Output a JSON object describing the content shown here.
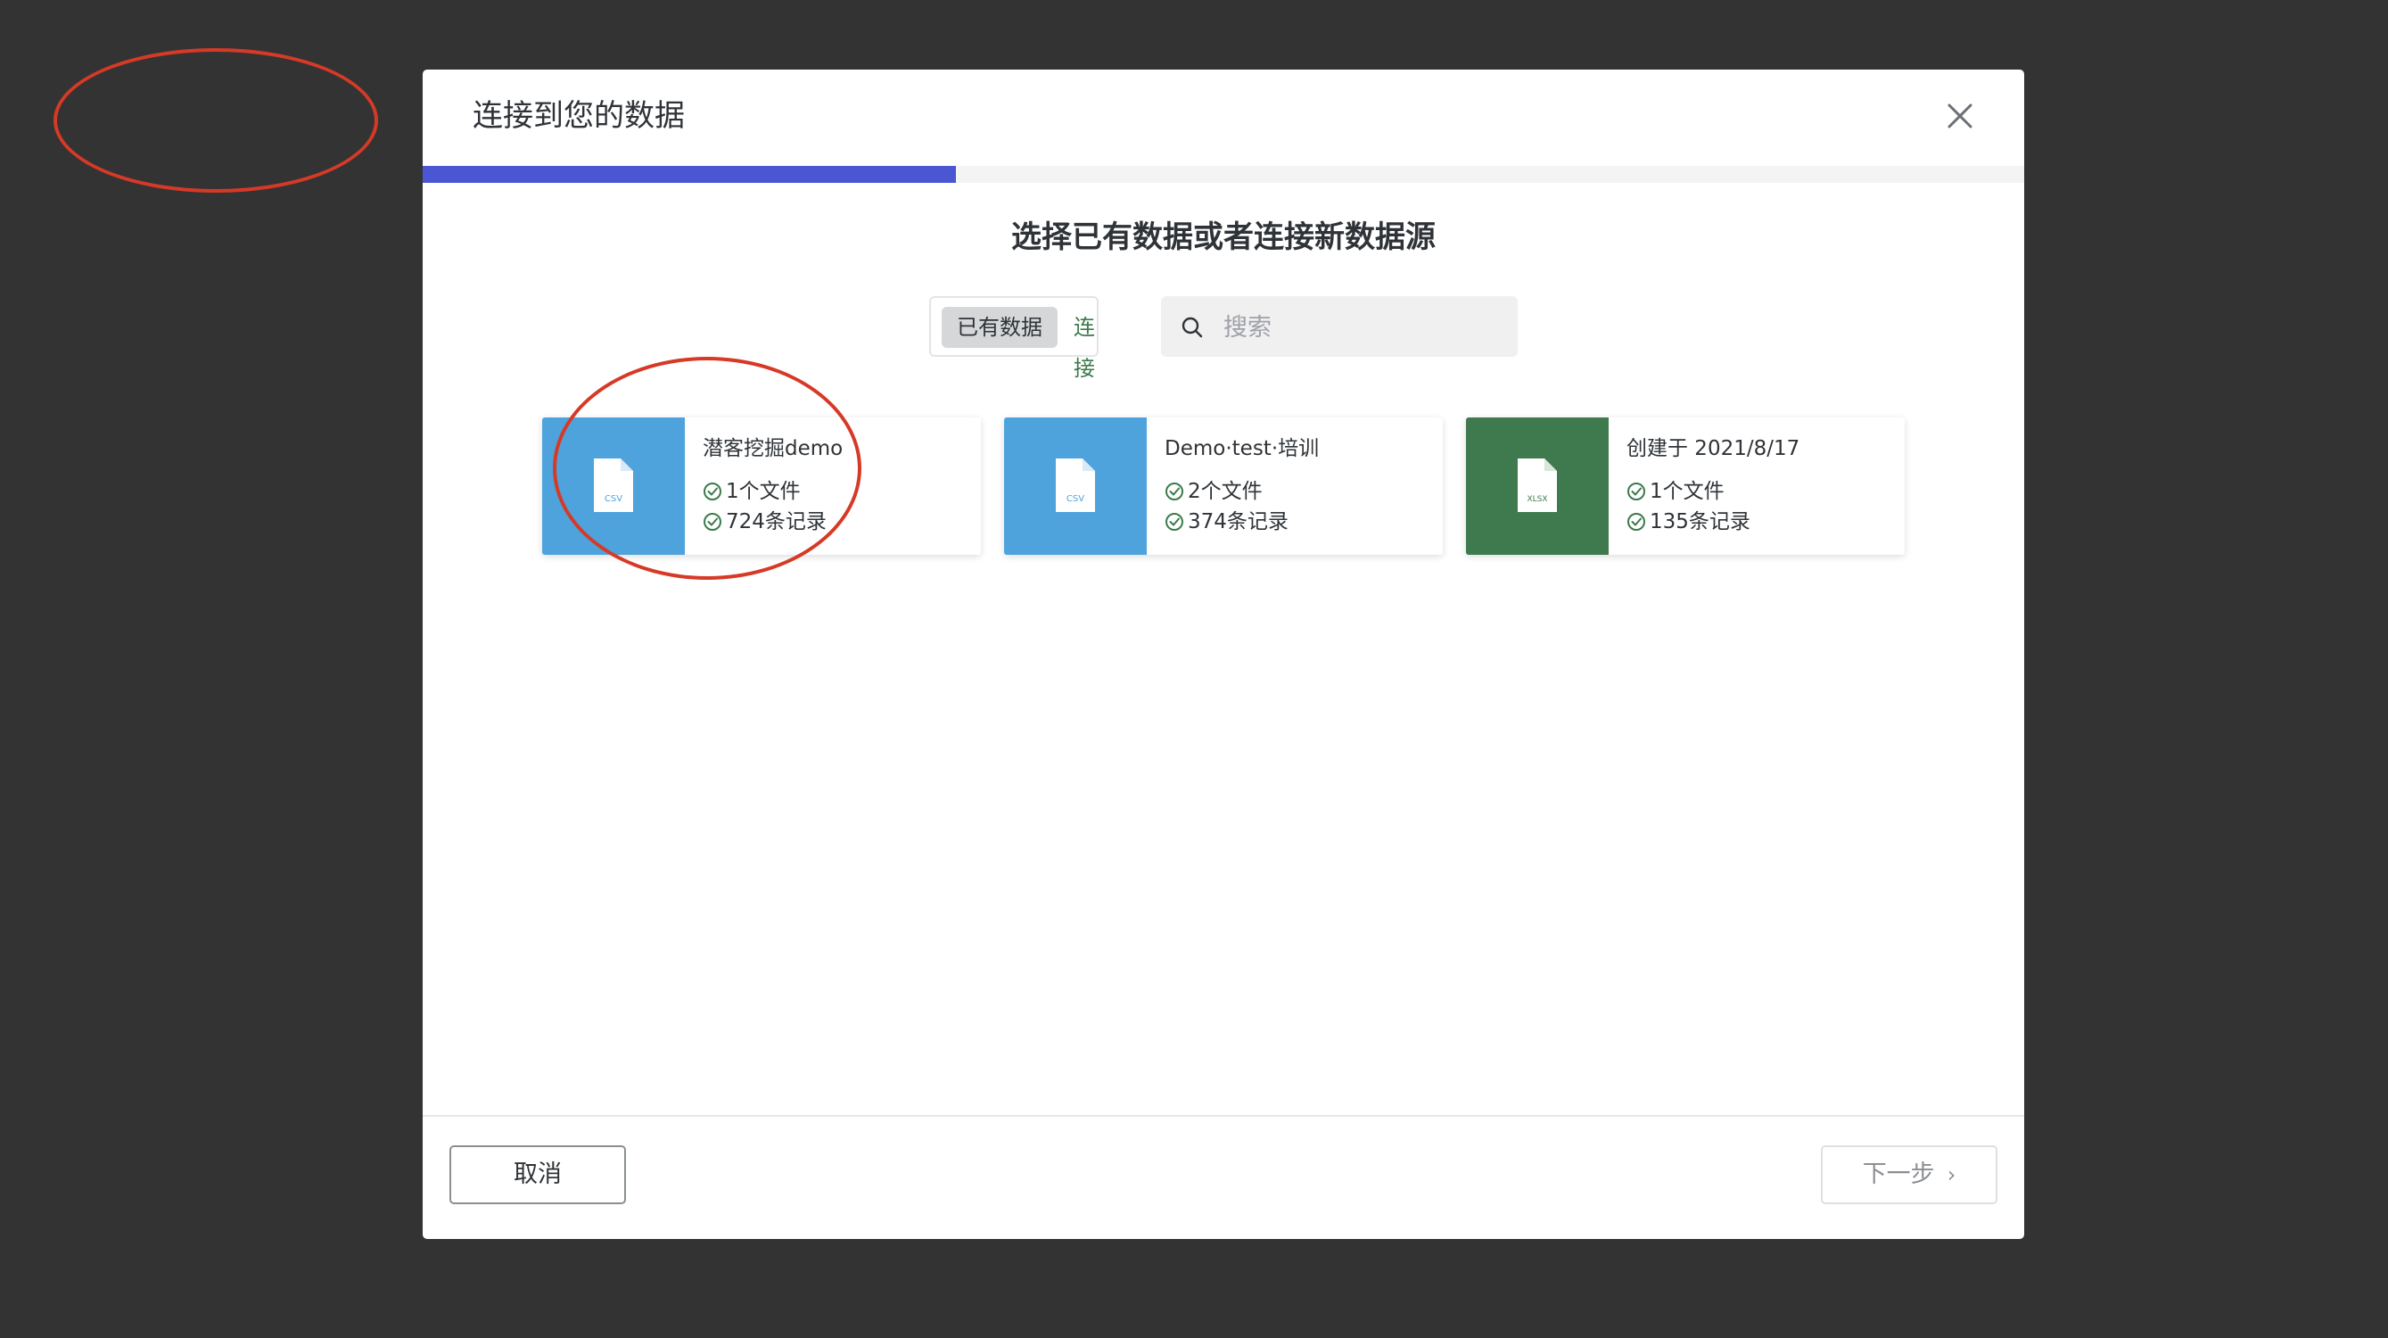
{
  "dialog": {
    "title": "连接到您的数据",
    "progress_fraction": 0.333,
    "subtitle": "选择已有数据或者连接新数据源"
  },
  "toggle": {
    "existing_label": "已有数据",
    "connect_label": "连接"
  },
  "search": {
    "placeholder": "搜索",
    "value": ""
  },
  "datasets": [
    {
      "name": "潜客挖掘demo",
      "file_type": "CSV",
      "files": "1个文件",
      "records": "724条记录",
      "thumb_color": "#4ea3dc"
    },
    {
      "name": "Demo·test·培训",
      "file_type": "CSV",
      "files": "2个文件",
      "records": "374条记录",
      "thumb_color": "#4ea3dc"
    },
    {
      "name": "创建于 2021/8/17",
      "file_type": "XLSX",
      "files": "1个文件",
      "records": "135条记录",
      "thumb_color": "#3f7a4f"
    }
  ],
  "footer": {
    "cancel_label": "取消",
    "next_label": "下一步"
  },
  "colors": {
    "accent": "#4b56d2",
    "link_green": "#3c7a4a",
    "annotation_red": "#d63a26",
    "backdrop": "#333333"
  },
  "icons": {
    "close": "close-icon",
    "search": "search-icon",
    "file": "file-icon",
    "check": "check-circle-icon",
    "next": "chevron-right-icon"
  }
}
